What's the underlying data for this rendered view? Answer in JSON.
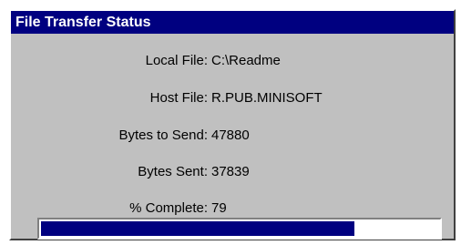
{
  "dialog": {
    "title": "File Transfer Status"
  },
  "fields": [
    {
      "label": "Local File:",
      "value": "C:\\Readme"
    },
    {
      "label": "Host File:",
      "value": "R.PUB.MINISOFT"
    },
    {
      "label": "Bytes to Send:",
      "value": "47880"
    },
    {
      "label": "Bytes Sent:",
      "value": "37839"
    },
    {
      "label": "% Complete:",
      "value": "79"
    }
  ],
  "progress": {
    "percent": 79
  },
  "colors": {
    "titlebar": "#000080",
    "window": "#c0c0c0",
    "progress_fill": "#000080"
  }
}
